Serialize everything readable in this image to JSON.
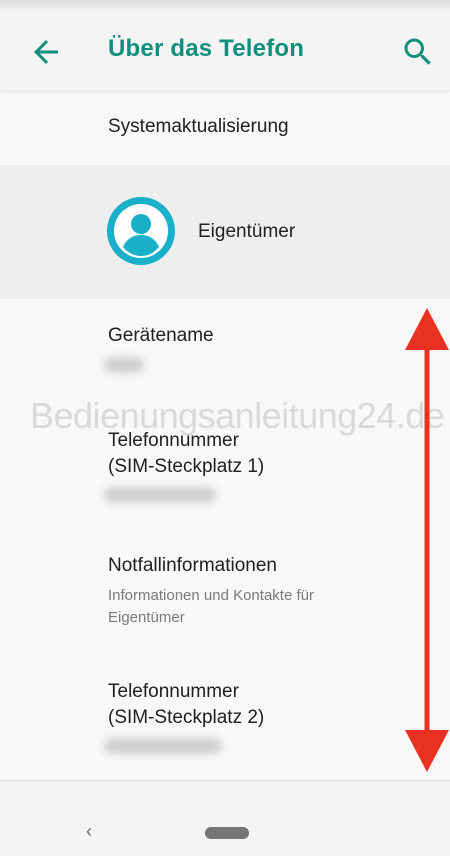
{
  "header": {
    "title": "Über das Telefon",
    "accent_color": "#0f8f7c",
    "back_icon": "arrow-left-icon",
    "search_icon": "search-icon"
  },
  "items": {
    "system_update": {
      "title": "Systemaktualisierung"
    },
    "owner": {
      "title": "Eigentümer",
      "icon": "account-circle-icon",
      "icon_color": "#1ab0c9"
    },
    "device_name": {
      "title": "Gerätename"
    },
    "phone_sim1": {
      "title_line1": "Telefonnummer",
      "title_line2": "(SIM-Steckplatz 1)"
    },
    "emergency": {
      "title": "Notfallinformationen",
      "subtitle_line1": "Informationen und Kontakte für",
      "subtitle_line2": "Eigentümer"
    },
    "phone_sim2": {
      "title_line1": "Telefonnummer",
      "title_line2": "(SIM-Steckplatz 2)"
    }
  },
  "watermark": "Bedienungsanleitung24.de",
  "annotation": {
    "arrow_color": "#e8321f"
  },
  "navbar": {
    "back_glyph": "‹"
  }
}
